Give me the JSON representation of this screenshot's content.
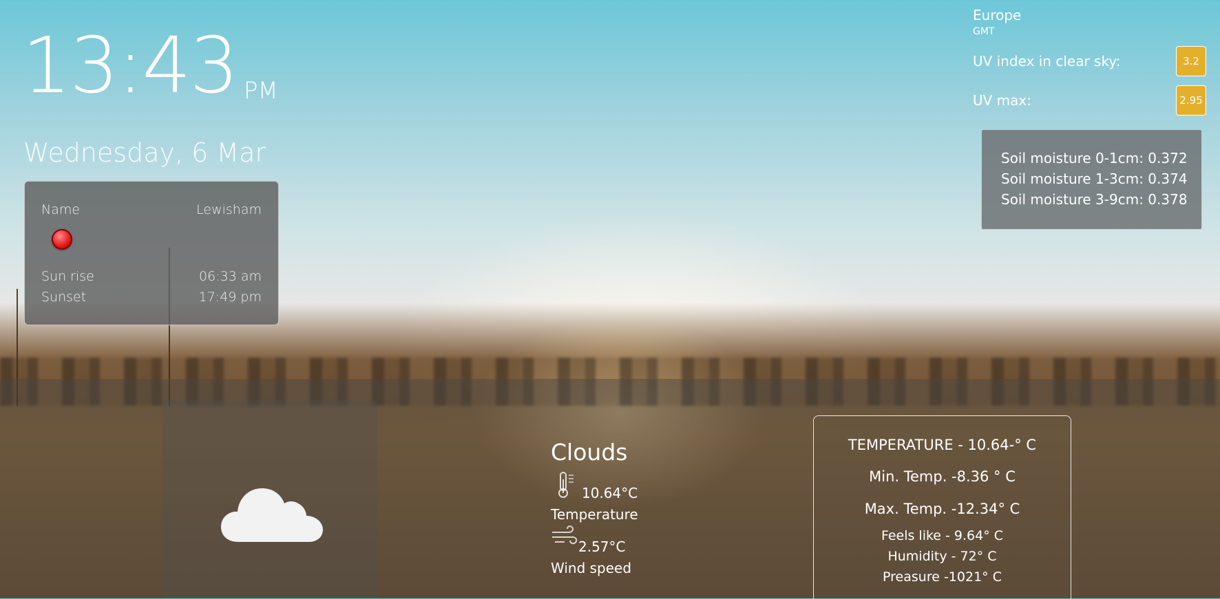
{
  "clock": {
    "time": "13:43",
    "ampm": "PM"
  },
  "date": "Wednesday, 6 Mar",
  "location_card": {
    "name_label": "Name",
    "name_value": "Lewisham",
    "status_color": "#e01818",
    "sunrise_label": "Sun rise",
    "sunrise_value": "06:33 am",
    "sunset_label": "Sunset",
    "sunset_value": "17:49 pm"
  },
  "region": {
    "name": "Europe",
    "timezone": "GMT"
  },
  "uv": {
    "clear_sky_label": "UV index in clear sky:",
    "clear_sky_value": "3.2",
    "max_label": "UV max:",
    "max_value": "2.95",
    "badge_color": "#e4b02b"
  },
  "soil": [
    "Soil moisture 0-1cm: 0.372",
    "Soil moisture 1-3cm: 0.374",
    "Soil moisture 3-9cm: 0.378"
  ],
  "current": {
    "condition": "Clouds",
    "condition_icon": "cloud-icon",
    "temperature_value": "10.64°C",
    "temperature_label": "Temperature",
    "temperature_icon": "thermometer-icon",
    "wind_value": "2.57°C",
    "wind_label": "Wind speed",
    "wind_icon": "wind-icon"
  },
  "details": {
    "temperature": "TEMPERATURE - 10.64-° C",
    "min_temp": "Min. Temp. -8.36 ° C",
    "max_temp": "Max. Temp. -12.34° C",
    "feels_like": "Feels like - 9.64° C",
    "humidity": "Humidity - 72° C",
    "pressure": "Preasure -1021° C"
  }
}
